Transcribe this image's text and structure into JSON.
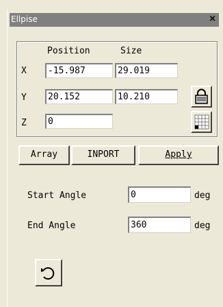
{
  "window": {
    "title": "Ellpise",
    "close_glyph": "×"
  },
  "group": {
    "position_header": "Position",
    "size_header": "Size",
    "rows": [
      {
        "axis": "X",
        "position": "-15.987",
        "size": "29.019"
      },
      {
        "axis": "Y",
        "position": "20.152",
        "size": "10.210"
      },
      {
        "axis": "Z",
        "position": "0"
      }
    ],
    "icons": {
      "lock": "lock-icon",
      "grid": "grid-anchor-icon"
    }
  },
  "buttons": {
    "array": "Array",
    "import": "INPORT",
    "apply": "Apply"
  },
  "angles": {
    "start_label": "Start Angle",
    "start_value": "0",
    "end_label": "End Angle",
    "end_value": "360",
    "unit": "deg"
  },
  "reset_icon": "rotate-ccw-icon"
}
